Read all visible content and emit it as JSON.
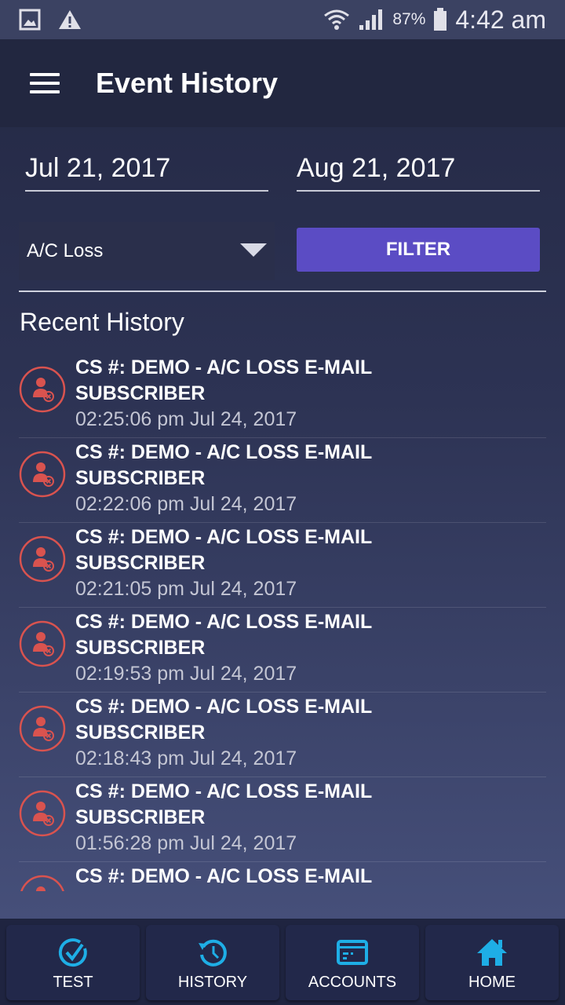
{
  "status": {
    "battery": "87%",
    "time": "4:42 am"
  },
  "header": {
    "title": "Event History"
  },
  "filters": {
    "start_date": "Jul 21, 2017",
    "end_date": "Aug 21, 2017",
    "event_type": "A/C Loss",
    "filter_label": "FILTER"
  },
  "recent_title": "Recent History",
  "items": [
    {
      "title": "CS #: DEMO - A/C LOSS E-MAIL SUBSCRIBER",
      "time": "02:25:06 pm Jul 24, 2017"
    },
    {
      "title": "CS #: DEMO - A/C LOSS E-MAIL SUBSCRIBER",
      "time": "02:22:06 pm Jul 24, 2017"
    },
    {
      "title": "CS #: DEMO - A/C LOSS E-MAIL SUBSCRIBER",
      "time": "02:21:05 pm Jul 24, 2017"
    },
    {
      "title": "CS #: DEMO - A/C LOSS E-MAIL SUBSCRIBER",
      "time": "02:19:53 pm Jul 24, 2017"
    },
    {
      "title": "CS #: DEMO - A/C LOSS E-MAIL SUBSCRIBER",
      "time": "02:18:43 pm Jul 24, 2017"
    },
    {
      "title": "CS #: DEMO - A/C LOSS E-MAIL SUBSCRIBER",
      "time": "01:56:28 pm Jul 24, 2017"
    },
    {
      "title": "CS #: DEMO - A/C LOSS E-MAIL",
      "time": ""
    }
  ],
  "nav": [
    {
      "label": "TEST",
      "icon": "check-circle-icon"
    },
    {
      "label": "HISTORY",
      "icon": "history-icon"
    },
    {
      "label": "ACCOUNTS",
      "icon": "card-icon"
    },
    {
      "label": "HOME",
      "icon": "home-icon"
    }
  ],
  "colors": {
    "accent": "#5b4cc4",
    "icon_red": "#d9534f",
    "nav_icon": "#1eaee6"
  }
}
